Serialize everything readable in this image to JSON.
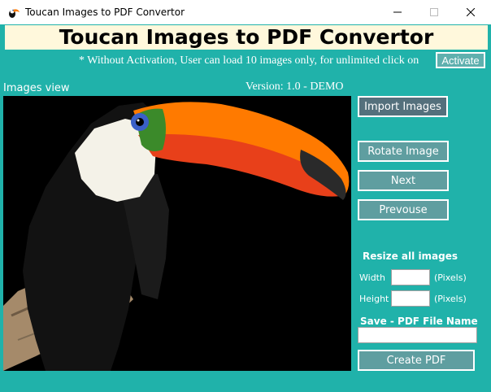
{
  "window": {
    "title": "Toucan Images to PDF Convertor",
    "controls": {
      "minimize": "—",
      "maximize": "☐",
      "close": "✕"
    }
  },
  "header": {
    "title": "Toucan Images to PDF Convertor",
    "activation_note": "* Without Activation, User can load 10 images only, for unlimited click on",
    "activate_label": "Activate"
  },
  "viewer": {
    "label": "Images view",
    "version": "Version: 1.0 - DEMO",
    "image_subject": "toucan-bird-photo"
  },
  "controls": {
    "import_label": "Import Images",
    "rotate_label": "Rotate Image",
    "next_label": "Next",
    "previous_label": "Prevouse",
    "resize_heading": "Resize all images",
    "width_label": "Width",
    "height_label": "Height",
    "pixels_unit": "(Pixels)",
    "width_value": "",
    "height_value": "",
    "save_heading": "Save - PDF File Name",
    "filename_value": "",
    "create_pdf_label": "Create PDF"
  },
  "colors": {
    "background": "#20b2aa",
    "banner": "#fff8dc",
    "button": "#5f9ea0",
    "import_button": "#54707c"
  },
  "icons": {
    "app": "toucan-icon"
  }
}
